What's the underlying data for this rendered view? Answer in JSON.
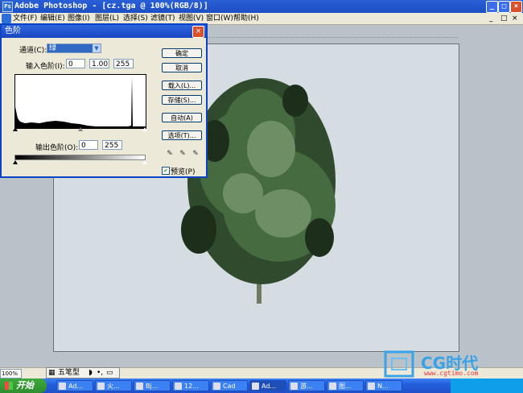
{
  "app": {
    "title": "Adobe Photoshop - [cz.tga @ 100%(RGB/8)]",
    "window_buttons": [
      "_",
      "□",
      "×"
    ]
  },
  "menu": [
    "文件(F)",
    "编辑(E)",
    "图像(I)",
    "图层(L)",
    "选择(S)",
    "滤镜(T)",
    "视图(V)",
    "窗口(W)",
    "帮助(H)"
  ],
  "doc_buttons": [
    "_",
    "□",
    "×"
  ],
  "levels_dialog": {
    "title": "色阶",
    "channel_label": "通道(C):",
    "channel_value": "绿",
    "input_label": "输入色阶(I):",
    "input_black": "0",
    "input_gamma": "1.00",
    "input_white": "255",
    "output_label": "输出色阶(O):",
    "output_black": "0",
    "output_white": "255",
    "buttons": {
      "ok": "确定",
      "cancel": "取消",
      "load": "载入(L)...",
      "save": "存储(S)...",
      "auto": "自动(A)",
      "options": "选项(T)..."
    },
    "preview_label": "预览(P)",
    "preview_checked": true
  },
  "status": {
    "zoom": "100%",
    "ime": "五笔型"
  },
  "taskbar": {
    "start": "开始",
    "items": [
      "Ad...",
      "火...",
      "Bj...",
      "12...",
      "Cad",
      "Ad...",
      "游...",
      "图...",
      "N..."
    ]
  },
  "watermark": {
    "brand": "CG时代",
    "url": "www.cgtimo.com"
  }
}
